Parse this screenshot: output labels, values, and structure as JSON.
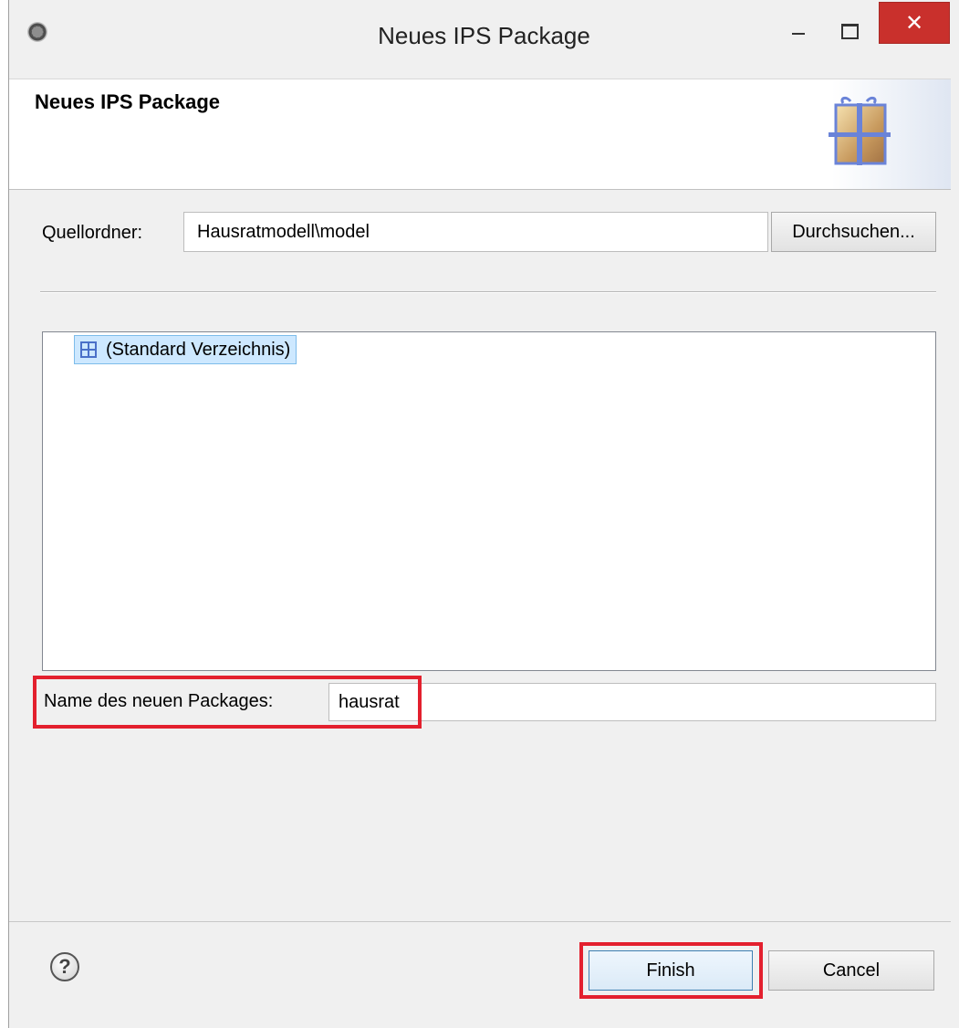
{
  "window": {
    "title": "Neues IPS Package",
    "close_glyph": "✕"
  },
  "header": {
    "title": "Neues IPS Package",
    "icon": "package-gift-icon"
  },
  "source_folder": {
    "label": "Quellordner:",
    "value": "Hausratmodell\\model",
    "browse_label": "Durchsuchen..."
  },
  "tree": {
    "items": [
      {
        "label": "(Standard Verzeichnis)",
        "icon": "package-icon",
        "selected": true
      }
    ]
  },
  "package_name": {
    "label": "Name des neuen Packages:",
    "value": "hausrat"
  },
  "footer": {
    "help_glyph": "?",
    "finish_label": "Finish",
    "cancel_label": "Cancel"
  },
  "colors": {
    "highlight": "#e3202e",
    "selection": "#cde8ff",
    "close_button": "#c9302c"
  }
}
